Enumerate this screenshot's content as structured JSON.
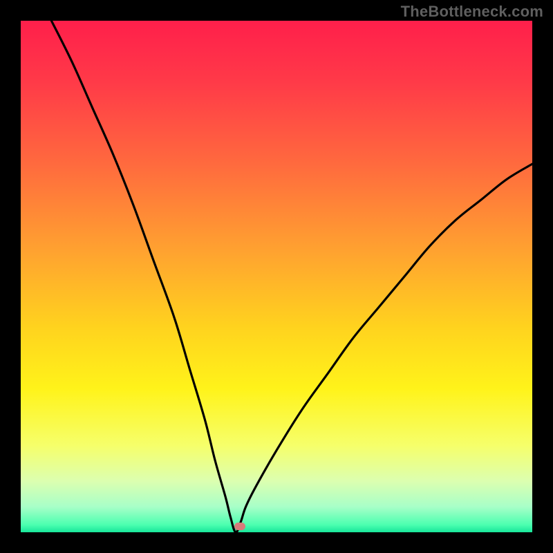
{
  "watermark": "TheBottleneck.com",
  "colors": {
    "frame_background": "#000000",
    "gradient_stops": [
      {
        "offset": 0.0,
        "color": "#ff1f4b"
      },
      {
        "offset": 0.12,
        "color": "#ff3a48"
      },
      {
        "offset": 0.28,
        "color": "#ff6a3e"
      },
      {
        "offset": 0.45,
        "color": "#ffa230"
      },
      {
        "offset": 0.6,
        "color": "#ffd31e"
      },
      {
        "offset": 0.72,
        "color": "#fff31a"
      },
      {
        "offset": 0.83,
        "color": "#f6ff6a"
      },
      {
        "offset": 0.9,
        "color": "#dcffb0"
      },
      {
        "offset": 0.95,
        "color": "#a8ffc8"
      },
      {
        "offset": 0.985,
        "color": "#4dffb0"
      },
      {
        "offset": 1.0,
        "color": "#18e69a"
      }
    ],
    "curve_stroke": "#000000",
    "marker_fill": "#d77b7a"
  },
  "chart_data": {
    "type": "line",
    "title": "",
    "xlabel": "",
    "ylabel": "",
    "xlim": [
      0,
      100
    ],
    "ylim": [
      0,
      100
    ],
    "grid": false,
    "legend": false,
    "notes": "V-shaped bottleneck curve over vertical red→green gradient. Minimum of curve sits near x≈42 at y≈0. Left branch starts near top-left and descends steeply; right branch rises with decreasing slope toward upper-right, reaching y≈72 at x=100.",
    "series": [
      {
        "name": "bottleneck-curve",
        "x": [
          6,
          10,
          14,
          18,
          22,
          26,
          30,
          33,
          36,
          38,
          40,
          41,
          42,
          43,
          44,
          46,
          50,
          55,
          60,
          65,
          70,
          75,
          80,
          85,
          90,
          95,
          100
        ],
        "values": [
          100,
          92,
          83,
          74,
          64,
          53,
          42,
          32,
          22,
          14,
          7,
          3,
          0,
          2,
          5,
          9,
          16,
          24,
          31,
          38,
          44,
          50,
          56,
          61,
          65,
          69,
          72
        ]
      }
    ],
    "marker": {
      "x": 42.8,
      "y": 1.2,
      "width": 2.2,
      "height": 1.5
    }
  }
}
